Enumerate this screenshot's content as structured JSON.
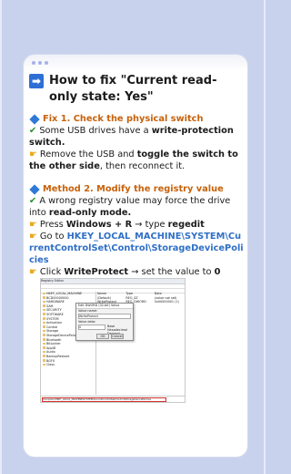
{
  "title": "How to fix \"Current read-only state: Yes\"",
  "icons": {
    "title": "arrow-right-icon",
    "section": "blue-diamond-icon",
    "check": "check-icon",
    "hand": "pointing-hand-icon"
  },
  "colors": {
    "background": "#c9d2ec",
    "section_title": "#c7610a",
    "registry_path": "#2f6fc6"
  },
  "fix1": {
    "heading": "Fix 1. Check the physical switch",
    "line1_prefix": " Some USB drives have a ",
    "line1_bold": "write-protection switch.",
    "line2_prefix": " Remove the USB and ",
    "line2_bold": "toggle the switch to the other side",
    "line2_suffix": ", then reconnect it."
  },
  "method2": {
    "heading": "Method 2. Modify the registry value",
    "line1_prefix": " A wrong registry value may force the drive into ",
    "line1_bold": "read-only mode.",
    "step1_prefix": " Press ",
    "step1_bold": "Windows + R",
    "step1_mid": " → type ",
    "step1_bold2": "regedit",
    "step2_prefix": " Go to ",
    "step2_path": "HKEY_LOCAL_MACHINE\\SYSTEM\\CurrentControlSet\\Control\\StorageDevicePolicies",
    "step3_prefix": " Click ",
    "step3_bold": "WriteProtect",
    "step3_mid": " → set the value to ",
    "step3_bold2": "0"
  },
  "registry_screenshot": {
    "window_title": "Registry Editor",
    "address": "Computer\\HKEY_LOCAL_MACHINE\\SYSTEM\\CurrentControlSet\\Control\\StorageDevicePolicies",
    "tree": [
      "HKEY_LOCAL_MACHINE",
      "BCD00000000",
      "HARDWARE",
      "SAM",
      "SECURITY",
      "SOFTWARE",
      "SYSTEM",
      "Activation",
      "Control",
      "Storage",
      "StorageDevicePolicies",
      "Bluetooth",
      "BitLocker",
      "AppID",
      "Audio",
      "BackupRestore",
      "BGFX",
      "Class"
    ],
    "value_headers": [
      "Name",
      "Type",
      "Data"
    ],
    "values": [
      [
        "(Default)",
        "REG_SZ",
        "(value not set)"
      ],
      [
        "WriteProtect",
        "REG_DWORD",
        "0x00000001 (1)"
      ]
    ],
    "dialog": {
      "title": "Edit DWORD (32-bit) Value",
      "value_name_label": "Value name:",
      "value_name": "WriteProtect",
      "value_data_label": "Value data:",
      "value_data": "0",
      "base_label": "Base",
      "base_hex": "Hexadecimal",
      "base_dec": "Decimal",
      "ok": "OK",
      "cancel": "Cancel"
    }
  }
}
